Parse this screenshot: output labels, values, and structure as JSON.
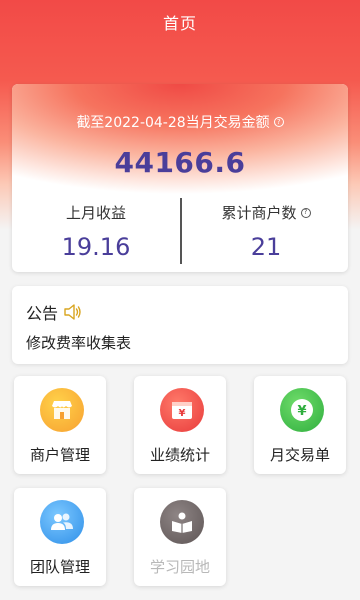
{
  "header": {
    "title": "首页"
  },
  "summary": {
    "label": "截至2022-04-28当月交易金额",
    "amount": "44166.6",
    "last_month_label": "上月收益",
    "last_month_value": "19.16",
    "merchants_label": "累计商户数",
    "merchants_value": "21"
  },
  "notice": {
    "title": "公告",
    "text": "修改费率收集表"
  },
  "menu": [
    {
      "label": "商户管理",
      "icon": "store-icon",
      "color": "#f7a030"
    },
    {
      "label": "业绩统计",
      "icon": "wallet-icon",
      "color": "#ee4a4a"
    },
    {
      "label": "月交易单",
      "icon": "yen-coin-icon",
      "color": "#3ec04c"
    },
    {
      "label": "团队管理",
      "icon": "team-icon",
      "color": "#3a9cf0"
    },
    {
      "label": "学习园地",
      "icon": "reading-icon",
      "color": "#6b6262"
    }
  ],
  "colors": {
    "accent_red": "#f24a47",
    "value_purple": "#4a3e9a",
    "speaker_gold": "#d9a520"
  }
}
